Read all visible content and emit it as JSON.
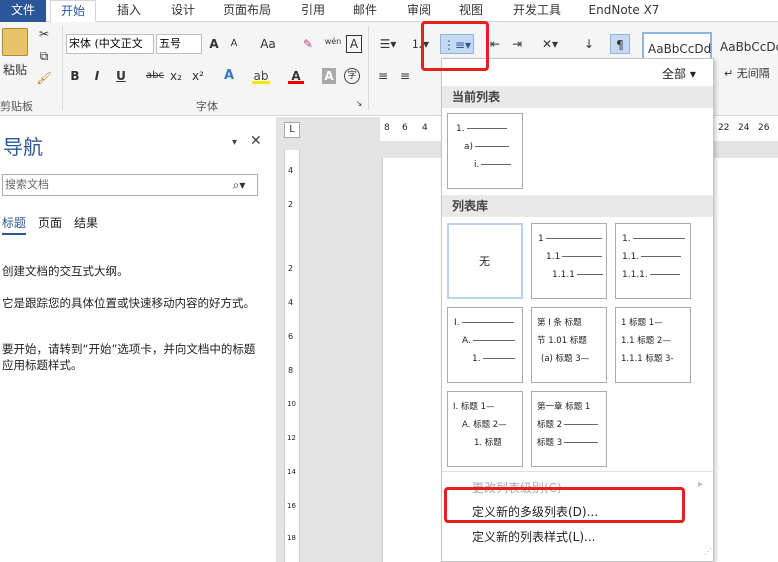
{
  "tabs": {
    "file": "文件",
    "items": [
      "开始",
      "插入",
      "设计",
      "页面布局",
      "引用",
      "邮件",
      "审阅",
      "视图",
      "开发工具",
      "EndNote X7"
    ]
  },
  "ribbon": {
    "clipboard": {
      "paste": "粘贴",
      "label": "剪贴板"
    },
    "font": {
      "name": "宋体 (中文正文",
      "size": "五号",
      "grow": "A",
      "shrink": "A",
      "case": "Aa",
      "bold": "B",
      "italic": "I",
      "underline": "U",
      "strike": "abc",
      "sub": "x₂",
      "sup": "x²",
      "label": "字体",
      "wen": "wén",
      "zi": "字",
      "a_box": "A",
      "circle": "字"
    },
    "styles": {
      "sample1": "AaBbCcDd",
      "sample2": "AaBbCcDd",
      "sample2_label": "↵ 无间隔",
      "all": "全部"
    }
  },
  "nav": {
    "title": "导航",
    "search_placeholder": "搜索文档",
    "tabs": [
      "标题",
      "页面",
      "结果"
    ],
    "para1": "创建文档的交互式大纲。",
    "para2": "它是跟踪您的具体位置或快速移动内容的好方式。",
    "para3": "要开始，请转到“开始”选项卡，并向文档中的标题应用标题样式。"
  },
  "ruler": {
    "h": [
      "8",
      "6",
      "4",
      "22",
      "24",
      "26"
    ],
    "v": [
      "4",
      "2",
      "2",
      "4",
      "6",
      "8",
      "10",
      "12",
      "14",
      "16",
      "18"
    ]
  },
  "dropdown": {
    "filter": "全部",
    "current_header": "当前列表",
    "current": [
      "1.",
      "a)",
      "i."
    ],
    "library_header": "列表库",
    "none": "无",
    "lib2": [
      "1",
      "1.1",
      "1.1.1"
    ],
    "lib3": [
      "1.",
      "1.1.",
      "1.1.1."
    ],
    "lib4": [
      "I.",
      "A.",
      "1."
    ],
    "lib5": [
      "第 I 条 标题",
      "节 1.01 标题",
      "(a) 标题 3—"
    ],
    "lib6": [
      "1 标题 1—",
      "1.1 标题 2—",
      "1.1.1 标题 3-"
    ],
    "lib7": [
      "I. 标题 1—",
      "A. 标题 2—",
      "1. 标题"
    ],
    "lib8": [
      "第一章 标题 1",
      "标题 2",
      "标题 3"
    ],
    "change_level": "更改列表级别(C)",
    "define_multi": "定义新的多级列表(D)...",
    "define_style": "定义新的列表样式(L)..."
  },
  "colors": {
    "accent": "#2b579a",
    "highlight": "#e6211a"
  }
}
